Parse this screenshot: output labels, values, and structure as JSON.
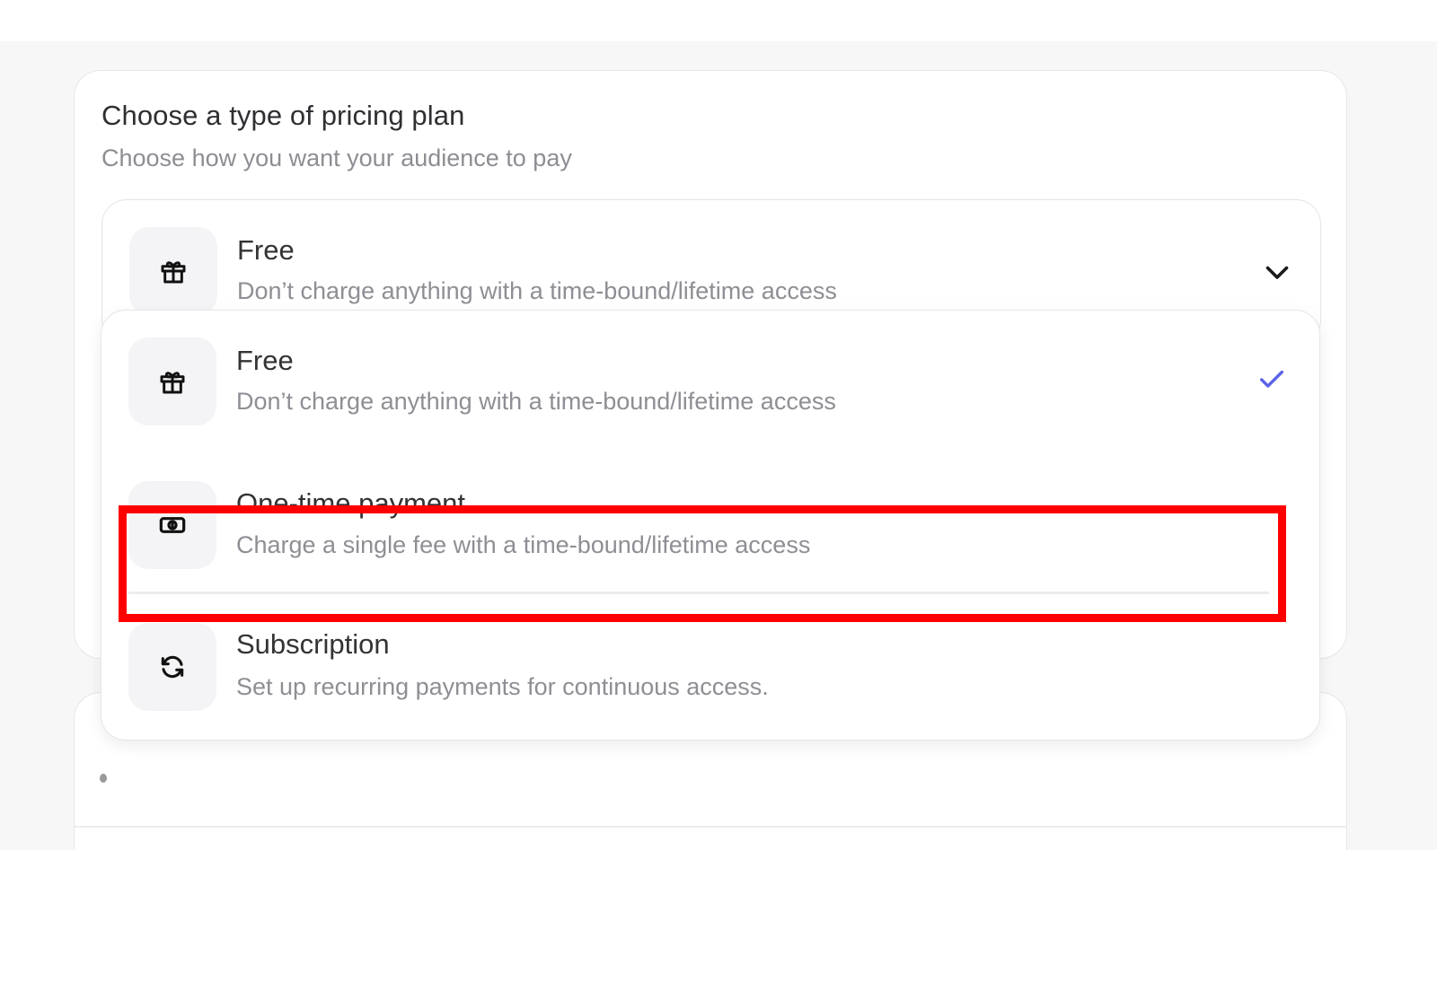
{
  "header": {
    "title": "Choose a type of pricing plan",
    "subtitle": "Choose how you want your audience to pay"
  },
  "select": {
    "selected_title": "Free",
    "selected_description": "Don’t charge anything with a time-bound/lifetime access",
    "icon": "gift-icon",
    "trailing_icon": "chevron-down-icon"
  },
  "dropdown": {
    "options": [
      {
        "title": "Free",
        "description": "Don’t charge anything with a time-bound/lifetime access",
        "icon": "gift-icon",
        "selected": true
      },
      {
        "title": "One-time payment",
        "description": "Charge a single fee with a time-bound/lifetime access",
        "icon": "cash-icon",
        "selected": false,
        "highlighted": true
      },
      {
        "title": "Subscription",
        "description": "Set up recurring payments for continuous access.",
        "icon": "refresh-icon",
        "selected": false
      }
    ]
  },
  "colors": {
    "check": "#5b63e6",
    "highlight": "#ff0000"
  }
}
